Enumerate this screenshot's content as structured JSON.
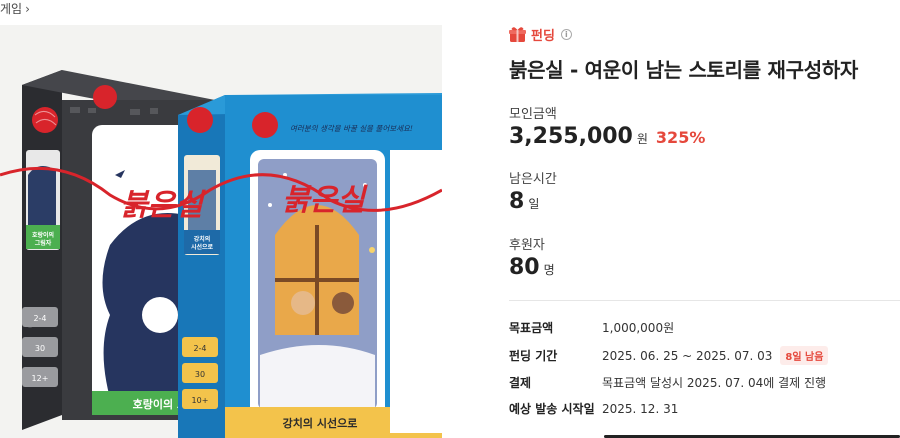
{
  "breadcrumb": {
    "label": "게임"
  },
  "product": {
    "box_title_art": "붉은실",
    "left_box": {
      "art_text": "호랑이의 그림자",
      "card_label": "호랑이의 그림자",
      "tags": [
        "2-4",
        "30",
        "12+"
      ]
    },
    "right_box": {
      "art_text": "강치의 시선으로",
      "card_label": "강치의 시선으로",
      "tags": [
        "2-4",
        "30",
        "10+"
      ]
    },
    "handwriting": "여러분의 생각을 바꿀 실을 풀어보세요!"
  },
  "funding": {
    "badge": "펀딩",
    "title": "붉은실 - 여운이 남는 스토리를 재구성하자",
    "raised_label": "모인금액",
    "raised_value": "3,255,000",
    "raised_unit": "원",
    "percent": "325%",
    "remaining_label": "남은시간",
    "remaining_value": "8",
    "remaining_unit": "일",
    "backers_label": "후원자",
    "backers_value": "80",
    "backers_unit": "명"
  },
  "details": [
    {
      "key": "목표금액",
      "value": "1,000,000원"
    },
    {
      "key": "펀딩 기간",
      "value": "2025. 06. 25 ~ 2025. 07. 03",
      "chip": "8일 남음"
    },
    {
      "key": "결제",
      "value": "목표금액 달성시 2025. 07. 04에 결제 진행"
    },
    {
      "key": "예상 발송 시작일",
      "value": "2025. 12. 31"
    }
  ],
  "colors": {
    "accent": "#e5483c",
    "box_left": "#3a3b3f",
    "box_right": "#1f8fd0",
    "thread": "#d8242b",
    "card_navy": "#26355f"
  }
}
